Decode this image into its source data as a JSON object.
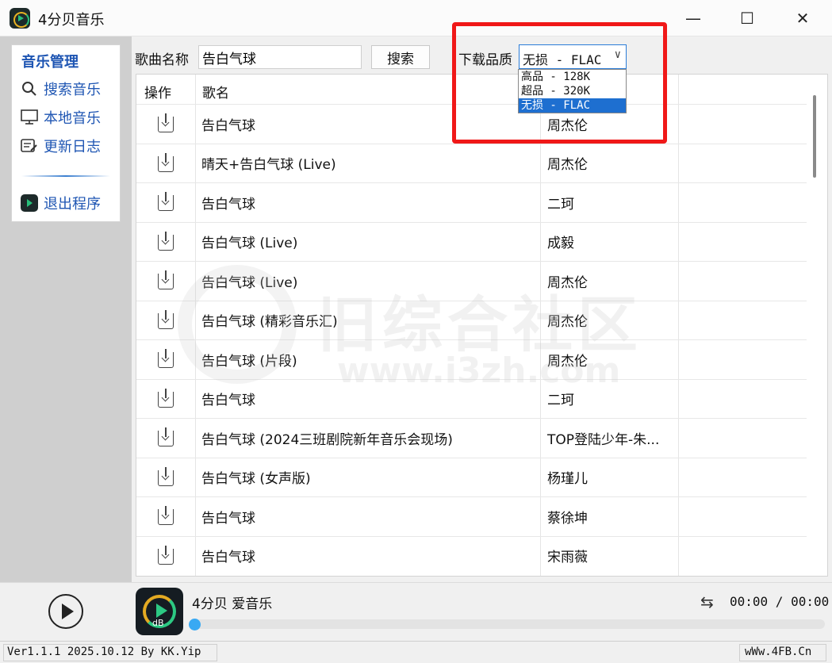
{
  "window": {
    "title": "4分贝音乐",
    "minimize": "—",
    "maximize": "☐",
    "close": "✕"
  },
  "sidebar": {
    "heading": "音乐管理",
    "items": [
      {
        "label": "搜索音乐",
        "icon": "search-icon"
      },
      {
        "label": "本地音乐",
        "icon": "monitor-icon"
      },
      {
        "label": "更新日志",
        "icon": "log-icon"
      },
      {
        "label": "退出程序",
        "icon": "exit-icon"
      }
    ]
  },
  "search": {
    "label": "歌曲名称",
    "value": "告白气球",
    "button": "搜索"
  },
  "quality": {
    "label": "下载品质",
    "selected": "无损 - FLAC",
    "options": [
      "高品 - 128K",
      "超品 - 320K",
      "无损 - FLAC"
    ]
  },
  "table": {
    "headers": {
      "action": "操作",
      "name": "歌名"
    },
    "rows": [
      {
        "name": "告白气球",
        "artist": "周杰伦"
      },
      {
        "name": "晴天+告白气球 (Live)",
        "artist": "周杰伦"
      },
      {
        "name": "告白气球",
        "artist": "二珂"
      },
      {
        "name": "告白气球 (Live)",
        "artist": "成毅"
      },
      {
        "name": "告白气球 (Live)",
        "artist": "周杰伦"
      },
      {
        "name": "告白气球 (精彩音乐汇)",
        "artist": "周杰伦"
      },
      {
        "name": "告白气球 (片段)",
        "artist": "周杰伦"
      },
      {
        "name": "告白气球",
        "artist": "二珂"
      },
      {
        "name": "告白气球 (2024三班剧院新年音乐会现场)",
        "artist": "TOP登陆少年-朱..."
      },
      {
        "name": "告白气球 (女声版)",
        "artist": "杨瑾儿"
      },
      {
        "name": "告白气球",
        "artist": "蔡徐坤"
      },
      {
        "name": "告白气球",
        "artist": "宋雨薇"
      }
    ]
  },
  "watermark": {
    "line1": "旧综合社区",
    "line2": "www.i3zh.com"
  },
  "player": {
    "now_playing": "4分贝 爱音乐",
    "cover_text": "dB",
    "time": "00:00 / 00:00",
    "progress": 0
  },
  "status": {
    "left": "Ver1.1.1 2025.10.12 By KK.Yip",
    "right": "wWw.4FB.Cn"
  },
  "colors": {
    "accent": "#1f56b3",
    "selection": "#1e6fd0",
    "highlight": "#f01818",
    "progress_knob": "#39a9f3"
  }
}
